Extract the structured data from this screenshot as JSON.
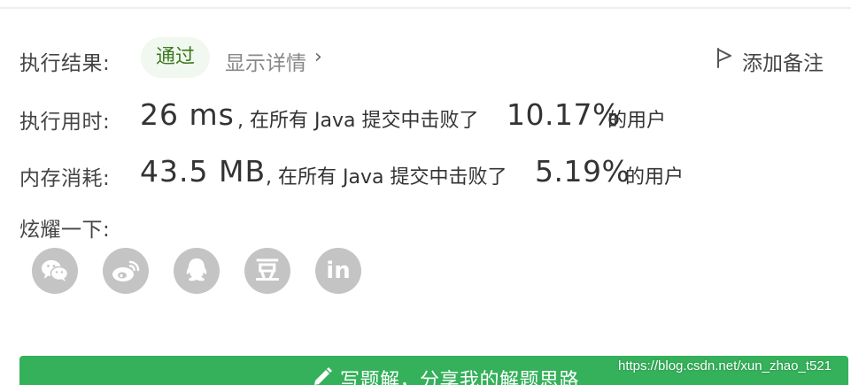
{
  "result": {
    "label": "执行结果:",
    "status": "通过",
    "detail_link": "显示详情",
    "detail_chevron": "›",
    "note_link": "添加备注"
  },
  "runtime": {
    "label": "执行用时:",
    "value": "26 ms",
    "prefix_text": ", 在所有 Java 提交中击败了",
    "percent": "10.17%",
    "suffix_text": "的用户"
  },
  "memory": {
    "label": "内存消耗:",
    "value": "43.5 MB",
    "prefix_text": ", 在所有 Java 提交中击败了",
    "percent": "5.19%",
    "suffix_text": "的用户"
  },
  "share": {
    "label": "炫耀一下:",
    "buttons": [
      {
        "icon": "wechat-icon"
      },
      {
        "icon": "weibo-icon"
      },
      {
        "icon": "qq-icon"
      },
      {
        "icon": "douban-icon",
        "glyph": "豆"
      },
      {
        "icon": "linkedin-icon",
        "glyph": "in"
      }
    ]
  },
  "write_solution": {
    "label": "写题解，分享我的解题思路"
  },
  "watermark": "https://blog.csdn.net/xun_zhao_t521",
  "colors": {
    "accent_green": "#34b15a",
    "badge_bg": "#f1f8ef",
    "badge_text": "#3c7a21",
    "icon_gray": "#c4c4c4"
  }
}
